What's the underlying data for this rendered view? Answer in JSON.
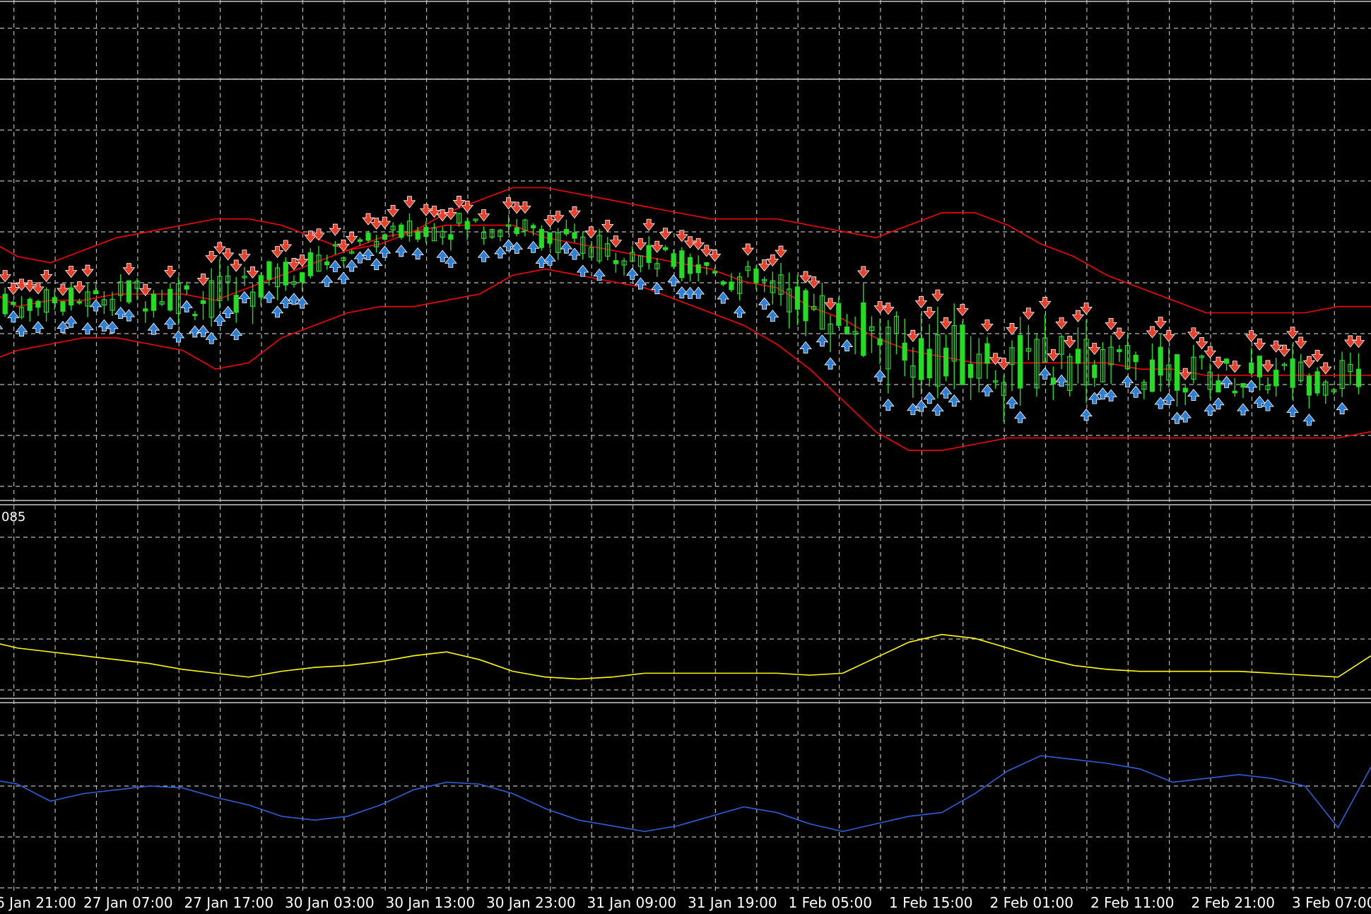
{
  "chart_data": [
    {
      "type": "line",
      "pane": "price",
      "x_unit": "hours",
      "x": [
        0,
        4,
        8,
        12,
        16,
        20,
        24,
        28,
        32,
        36,
        40,
        44,
        48,
        52,
        56,
        60,
        64,
        68,
        72,
        76,
        80,
        84,
        88,
        92,
        96,
        100,
        104,
        108,
        112,
        116,
        120,
        124,
        128,
        132,
        136,
        140,
        144,
        148,
        152,
        156,
        160,
        164,
        168
      ],
      "series": [
        {
          "name": "",
          "color": "#ff0000",
          "values": [
            262,
            259,
            258,
            260,
            262,
            263,
            264,
            265,
            265,
            264,
            262,
            260,
            261,
            263,
            266,
            268,
            270,
            270,
            269,
            268,
            267,
            266,
            265,
            265,
            265,
            264,
            263,
            262,
            264,
            266,
            266,
            264,
            261,
            259,
            256,
            254,
            252,
            250,
            250,
            250,
            250,
            251,
            251
          ]
        },
        {
          "name": "",
          "color": "#ff0000",
          "values": [
            254,
            251,
            252,
            252,
            253,
            253,
            253,
            252,
            254,
            256,
            258,
            260,
            262,
            263,
            264,
            264,
            264,
            262,
            261,
            260,
            259,
            258,
            257,
            255,
            254,
            251,
            249,
            246,
            244,
            243,
            242,
            242,
            242,
            242,
            242,
            241,
            241,
            240,
            240,
            240,
            240,
            240,
            240
          ]
        },
        {
          "name": "",
          "color": "#ff0000",
          "values": [
            242,
            244,
            245,
            246,
            246,
            245,
            244,
            241,
            242,
            246,
            248,
            250,
            251,
            251,
            252,
            253,
            256,
            257,
            256,
            255,
            254,
            252,
            250,
            248,
            245,
            241,
            236,
            231,
            228,
            228,
            229,
            230,
            230,
            230,
            230,
            230,
            230,
            230,
            230,
            230,
            230,
            230,
            231
          ]
        }
      ],
      "markers": {
        "sell_color": "#e8402a",
        "buy_color": "#2d7fd6",
        "candle_color": "#22dd22",
        "sell_icon": "arrow-down-icon",
        "buy_icon": "arrow-up-icon"
      },
      "ylim": [
        220,
        300
      ]
    },
    {
      "type": "line",
      "pane": "indicator-1",
      "pane_label": "085",
      "x_unit": "hours",
      "x": [
        0,
        4,
        8,
        12,
        16,
        20,
        24,
        28,
        32,
        36,
        40,
        44,
        48,
        52,
        56,
        60,
        64,
        68,
        72,
        76,
        80,
        84,
        88,
        92,
        96,
        100,
        104,
        108,
        112,
        116,
        120,
        124,
        128,
        132,
        136,
        140,
        144,
        148,
        152,
        156,
        160,
        164,
        168
      ],
      "series": [
        {
          "name": "",
          "color": "#ffff00",
          "values": [
            30,
            26,
            24,
            22,
            20,
            18,
            15,
            13,
            11,
            14,
            16,
            17,
            19,
            22,
            24,
            20,
            14,
            11,
            10,
            11,
            13,
            13,
            13,
            13,
            13,
            12,
            13,
            21,
            29,
            33,
            31,
            26,
            21,
            17,
            15,
            14,
            14,
            14,
            14,
            13,
            12,
            11,
            22
          ]
        }
      ],
      "ylim": [
        0,
        100
      ]
    },
    {
      "type": "line",
      "pane": "indicator-2",
      "x_unit": "hours",
      "x": [
        0,
        4,
        8,
        12,
        16,
        20,
        24,
        28,
        32,
        36,
        40,
        44,
        48,
        52,
        56,
        60,
        64,
        68,
        72,
        76,
        80,
        84,
        88,
        92,
        96,
        100,
        104,
        108,
        112,
        116,
        120,
        124,
        128,
        132,
        136,
        140,
        144,
        148,
        152,
        156,
        160,
        164,
        168
      ],
      "series": [
        {
          "name": "",
          "color": "#2c5fd8",
          "values": [
            60,
            57,
            48,
            52,
            54,
            56,
            55,
            50,
            46,
            40,
            38,
            40,
            46,
            54,
            58,
            57,
            52,
            44,
            38,
            35,
            32,
            35,
            40,
            45,
            42,
            36,
            32,
            36,
            40,
            42,
            52,
            64,
            72,
            70,
            68,
            65,
            58,
            60,
            62,
            60,
            56,
            34,
            66
          ]
        }
      ],
      "ylim": [
        0,
        100
      ]
    }
  ],
  "x_axis": {
    "tick_labels": [
      "6 Jan 21:00",
      "27 Jan 07:00",
      "27 Jan 17:00",
      "30 Jan 03:00",
      "30 Jan 13:00",
      "30 Jan 23:00",
      "31 Jan 09:00",
      "31 Jan 19:00",
      "1 Feb 05:00",
      "1 Feb 15:00",
      "2 Feb 01:00",
      "2 Feb 11:00",
      "2 Feb 21:00",
      "3 Feb 07:00"
    ]
  },
  "colors": {
    "background": "#000000",
    "grid": "#b8b8b8",
    "separator": "#c8c8c8",
    "text": "#ffffff"
  }
}
